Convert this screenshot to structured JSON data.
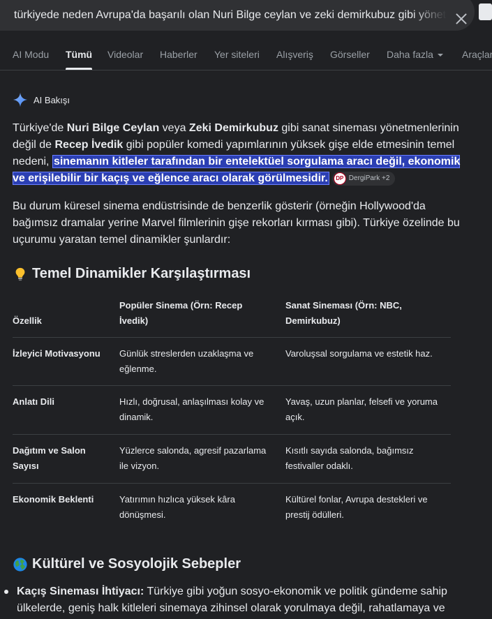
{
  "search": {
    "query": "türkiyede neden Avrupa'da başarılı olan Nuri Bilge ceylan ve zeki demirkubuz gibi yönetmenlerin"
  },
  "tabs": [
    {
      "label": "AI Modu"
    },
    {
      "label": "Tümü",
      "active": true
    },
    {
      "label": "Videolar"
    },
    {
      "label": "Haberler"
    },
    {
      "label": "Yer siteleri"
    },
    {
      "label": "Alışveriş"
    },
    {
      "label": "Görseller"
    },
    {
      "label": "Daha fazla"
    },
    {
      "label": "Araçlar"
    }
  ],
  "ai_overview": {
    "title": "AI Bakışı",
    "intro": {
      "t1": "Türkiye'de ",
      "b1": "Nuri Bilge Ceylan",
      "t2": " veya ",
      "b2": "Zeki Demirkubuz",
      "t3": " gibi sanat sineması yönetmenlerinin değil de ",
      "b3": "Recep İvedik",
      "t4": " gibi popüler komedi yapımlarının yüksek gişe elde etmesinin temel nedeni, ",
      "highlight": "sinemanın kitleler tarafından bir entelektüel sorgulama aracı değil, ekonomik ve erişilebilir bir kaçış ve eğlence aracı olarak görülmesidir.",
      "chip_logo": "DP",
      "chip_label": "DergiPark +2"
    },
    "para2": "Bu durum küresel sinema endüstrisinde de benzerlik gösterir (örneğin Hollywood'da bağımsız dramalar yerine Marvel filmlerinin gişe rekorları kırması gibi). Türkiye özelinde bu uçurumu yaratan temel dinamikler şunlardır:",
    "section1": "Temel Dinamikler Karşılaştırması",
    "table": {
      "headers": [
        "Özellik",
        "Popüler Sinema (Örn: Recep İvedik)",
        "Sanat Sineması (Örn: NBC, Demirkubuz)"
      ],
      "rows": [
        [
          "İzleyici Motivasyonu",
          "Günlük streslerden uzaklaşma ve eğlenme.",
          "Varoluşsal sorgulama ve estetik haz."
        ],
        [
          "Anlatı Dili",
          "Hızlı, doğrusal, anlaşılması kolay ve dinamik.",
          "Yavaş, uzun planlar, felsefi ve yoruma açık."
        ],
        [
          "Dağıtım ve Salon Sayısı",
          "Yüzlerce salonda, agresif pazarlama ile vizyon.",
          "Kısıtlı sayıda salonda, bağımsız festivaller odaklı."
        ],
        [
          "Ekonomik Beklenti",
          "Yatırımın hızlıca yüksek kâra dönüşmesi.",
          "Kültürel fonlar, Avrupa destekleri ve prestij ödülleri."
        ]
      ]
    },
    "section2": "Kültürel ve Sosyolojik Sebepler",
    "bullet1": {
      "term": "Kaçış Sineması İhtiyacı:",
      "text": " Türkiye gibi yoğun sosyo-ekonomik ve politik gündeme sahip ülkelerde, geniş halk kitleleri sinemaya zihinsel olarak yorulmaya değil, rahatlamaya ve"
    }
  }
}
